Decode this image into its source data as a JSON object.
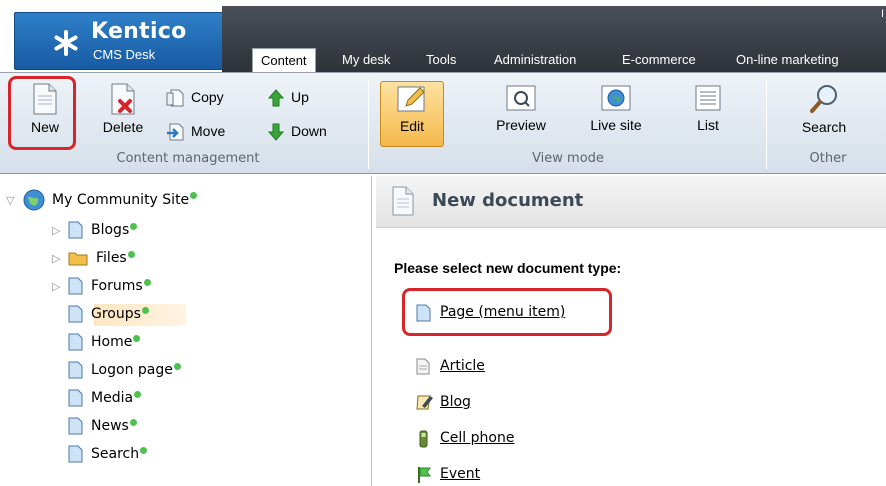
{
  "brand": {
    "name": "Kentico",
    "product": "CMS Desk"
  },
  "main_tabs": [
    "Content",
    "My desk",
    "Tools",
    "Administration",
    "E-commerce",
    "On-line marketing"
  ],
  "active_tab": "Content",
  "header_corner_text": "I",
  "toolbar": {
    "groups": [
      "Content management",
      "View mode",
      "Other"
    ],
    "new_label": "New",
    "delete_label": "Delete",
    "copy_label": "Copy",
    "move_label": "Move",
    "up_label": "Up",
    "down_label": "Down",
    "edit_label": "Edit",
    "preview_label": "Preview",
    "live_site_label": "Live site",
    "list_label": "List",
    "search_label": "Search"
  },
  "tree": {
    "root": "My Community Site",
    "items": [
      "Blogs",
      "Files",
      "Forums",
      "Groups",
      "Home",
      "Logon page",
      "Media",
      "News",
      "Search"
    ],
    "selected": "Groups"
  },
  "content": {
    "title": "New document",
    "prompt": "Please select new document type:",
    "doc_types": [
      "Page (menu item)",
      "Article",
      "Blog",
      "Cell phone",
      "Event"
    ]
  },
  "colors": {
    "accent_red": "#d7262b",
    "published_dot": "#4ec24e",
    "edit_active": "#f5b94b"
  }
}
